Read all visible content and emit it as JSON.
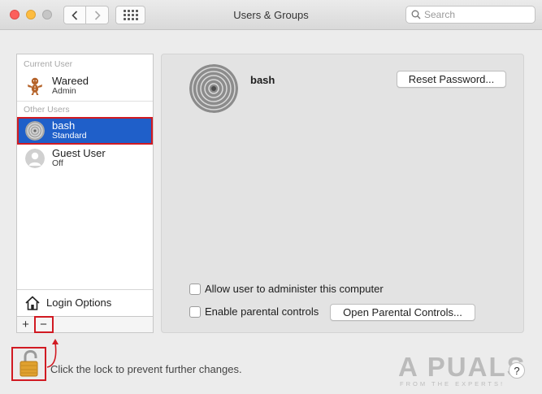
{
  "window": {
    "title": "Users & Groups"
  },
  "search": {
    "placeholder": "Search"
  },
  "sidebar": {
    "current_user_label": "Current User",
    "other_users_label": "Other Users",
    "current_user": {
      "name": "Wareed",
      "role": "Admin",
      "avatar_icon": "gingerbread-icon"
    },
    "other_users": [
      {
        "name": "bash",
        "role": "Standard",
        "avatar_icon": "zen-sand-icon",
        "selected": true
      },
      {
        "name": "Guest User",
        "role": "Off",
        "avatar_icon": "guest-silhouette-icon",
        "selected": false
      }
    ],
    "login_options_label": "Login Options",
    "add_symbol": "+",
    "remove_symbol": "−"
  },
  "panel": {
    "user_name": "bash",
    "reset_password_label": "Reset Password...",
    "allow_admin_label": "Allow user to administer this computer",
    "parental_controls_label": "Enable parental controls",
    "open_parental_label": "Open Parental Controls...",
    "allow_admin_checked": false,
    "parental_controls_checked": false
  },
  "lock": {
    "message": "Click the lock to prevent further changes."
  },
  "help": {
    "label": "?"
  },
  "watermark": {
    "main": "A PUALS",
    "sub": "FROM THE EXPERTS!"
  },
  "colors": {
    "selection": "#1f5fc9",
    "highlight_outline": "#d11a22"
  }
}
